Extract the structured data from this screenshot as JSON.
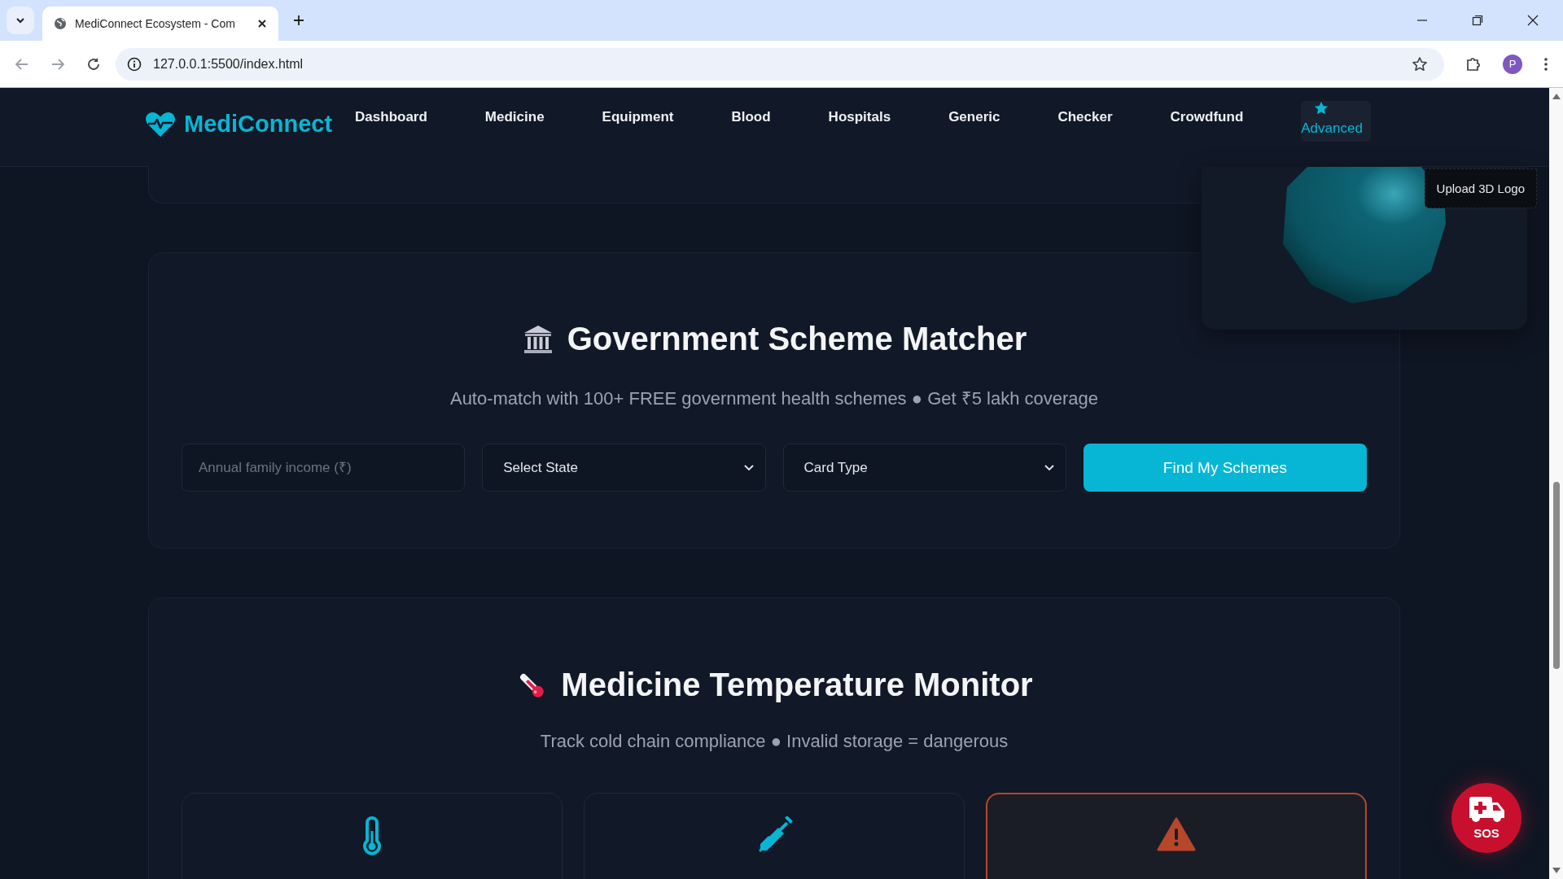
{
  "browser": {
    "tab_title": "MediConnect Ecosystem - Com",
    "url": "127.0.0.1:5500/index.html",
    "profile_initial": "P"
  },
  "nav": {
    "brand": "MediConnect",
    "items": [
      {
        "label": "Dashboard",
        "kind": "link",
        "selected": false
      },
      {
        "label": "Medicine",
        "kind": "link",
        "selected": false
      },
      {
        "label": "Equipment",
        "kind": "link",
        "selected": false
      },
      {
        "label": "Blood",
        "kind": "link",
        "selected": false
      },
      {
        "label": "Hospitals",
        "kind": "link",
        "selected": false
      },
      {
        "label": "Generic",
        "kind": "link",
        "selected": false
      },
      {
        "label": "Checker",
        "kind": "link",
        "selected": false
      },
      {
        "label": "Crowdfund",
        "kind": "link",
        "selected": false
      },
      {
        "label": "Advanced",
        "kind": "starred",
        "selected": true
      }
    ]
  },
  "logo_widget": {
    "upload_label": "Upload 3D Logo"
  },
  "scheme_matcher": {
    "title": "Government Scheme Matcher",
    "subtitle": "Auto-match with 100+ FREE government health schemes ● Get ₹5 lakh coverage",
    "income": {
      "placeholder": "Annual family income (₹)"
    },
    "selects": [
      "Select State",
      "Card Type"
    ],
    "button": "Find My Schemes"
  },
  "temperature_monitor": {
    "title": "Medicine Temperature Monitor",
    "subtitle": "Track cold chain compliance ● Invalid storage = dangerous",
    "cards": [
      {
        "kind": "thermometer",
        "alert": false
      },
      {
        "kind": "syringe",
        "alert": false
      },
      {
        "kind": "warning",
        "alert": true
      }
    ]
  },
  "sos": {
    "label": "SOS"
  }
}
